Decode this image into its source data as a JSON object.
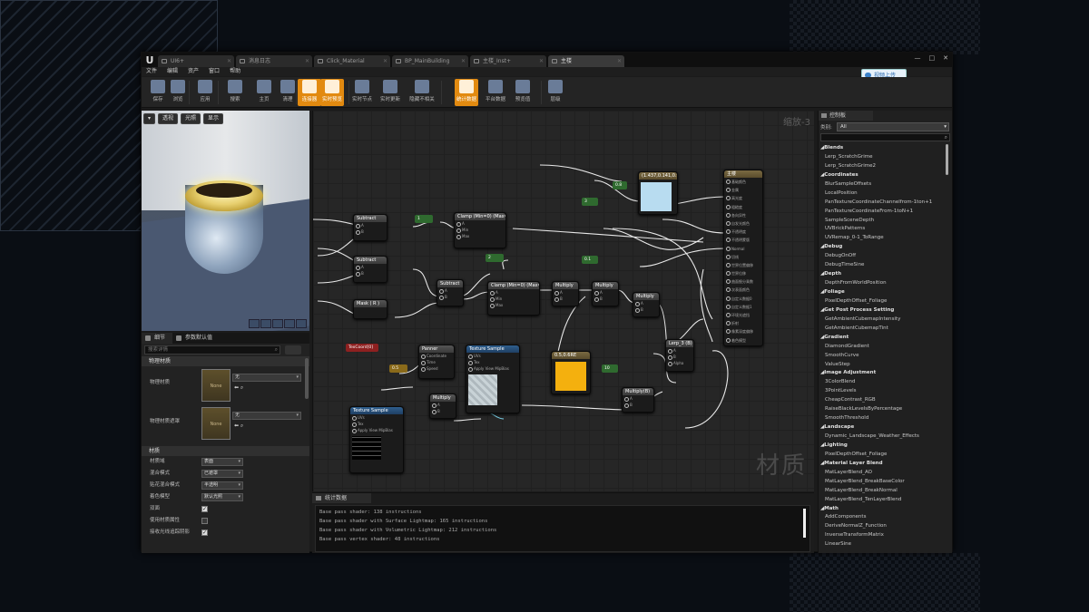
{
  "tabs": [
    {
      "label": "UI6+",
      "active": false
    },
    {
      "label": "消息日志",
      "active": false
    },
    {
      "label": "Click_Material",
      "active": false
    },
    {
      "label": "BP_MainBuilding",
      "active": false
    },
    {
      "label": "主楼_Inst+",
      "active": false
    },
    {
      "label": "主楼",
      "active": true
    }
  ],
  "menu": [
    "文件",
    "编辑",
    "资产",
    "窗口",
    "帮助"
  ],
  "upload_button": "视频上传",
  "toolbar": [
    {
      "label": "保存",
      "icon": "save-icon"
    },
    {
      "label": "浏览",
      "icon": "browse-icon"
    },
    {
      "label": "应用",
      "icon": "apply-icon"
    },
    {
      "label": "搜索",
      "icon": "search-icon"
    },
    {
      "label": "主页",
      "icon": "home-icon"
    },
    {
      "label": "清理",
      "icon": "clean-icon"
    },
    {
      "label": "连接器",
      "icon": "connector-icon",
      "highlighted": true
    },
    {
      "label": "实时预览",
      "icon": "live-preview-icon",
      "highlighted": true
    },
    {
      "label": "实时节点",
      "icon": "live-nodes-icon"
    },
    {
      "label": "实时更新",
      "icon": "live-update-icon"
    },
    {
      "label": "隐藏不相关",
      "icon": "hide-unrelated-icon"
    },
    {
      "label": "统计数据",
      "icon": "stats-icon",
      "highlighted": true
    },
    {
      "label": "平台数据",
      "icon": "platform-stats-icon"
    },
    {
      "label": "预览值",
      "icon": "preview-values-icon"
    },
    {
      "label": "层级",
      "icon": "hierarchy-icon"
    }
  ],
  "viewport": {
    "buttons": [
      "透视",
      "光照",
      "显示"
    ]
  },
  "details": {
    "tabs": [
      "细节",
      "参数默认值"
    ],
    "search_placeholder": "搜索详情",
    "cat_physical": "物理材质",
    "phys_mat_label": "物理材质",
    "phys_mask_label": "物理材质遮罩",
    "none_label": "None",
    "none_value": "无",
    "cat_material": "材质",
    "props": [
      {
        "label": "材质域",
        "value": "表面",
        "type": "select"
      },
      {
        "label": "混合模式",
        "value": "已遮罩",
        "type": "select"
      },
      {
        "label": "贴花混合模式",
        "value": "半透明",
        "type": "select"
      },
      {
        "label": "着色模型",
        "value": "默认光照",
        "type": "select"
      },
      {
        "label": "双面",
        "value": true,
        "type": "check"
      },
      {
        "label": "使用材质属性",
        "value": false,
        "type": "check"
      },
      {
        "label": "接收光线追踪阴影",
        "value": true,
        "type": "check"
      }
    ]
  },
  "graph": {
    "zoom": "缩放-3",
    "watermark": "材质",
    "nodes": {
      "subtract1": "Subtract",
      "subtract2": "Subtract",
      "subtract3": "Subtract",
      "clamp1": "Clamp (Min=0) (Max=1)",
      "clamp2": "Clamp (Min=0) (Max=1)",
      "multiply1": "Multiply",
      "multiply2": "Multiply",
      "multiply3": "Multiply",
      "multiply4": "Multiply",
      "multiply5": "Multiply(B)",
      "lerp": "Lerp_3 (B)",
      "panner": "Panner",
      "texsample1": "Texture Sample",
      "texsample2": "Texture Sample",
      "texcoord": "TexCoord[0]",
      "mask": "Mask ( R )",
      "color_vec": "(1.437,0.141,0.983)",
      "orange": "0.5,0.6RE",
      "output": "主楼",
      "const_1": "1",
      "const_01": "0.1",
      "const_10": "10",
      "const_05": "0.5",
      "const_2": "2",
      "const_08": "0.8",
      "const_3": "3"
    },
    "output_pins": [
      "基础颜色",
      "金属",
      "高光度",
      "粗糙度",
      "各向异性",
      "自发光颜色",
      "不透明度",
      "不透明蒙版",
      "Normal",
      "切线",
      "世界位置偏移",
      "世界位移",
      "曲面细分乘数",
      "次表面颜色",
      "自定义数据0",
      "自定义数据1",
      "环境光遮挡",
      "折射",
      "像素深度偏移",
      "着色模型"
    ],
    "pin_labels": {
      "A": "A",
      "B": "B",
      "Min": "Min",
      "Max": "Max",
      "Alpha": "Alpha",
      "UVs": "UVs",
      "Tex": "Tex",
      "Coordinate": "Coordinate",
      "Time": "Time",
      "Speed": "Speed",
      "ApplyViewMipBias": "Apply View MipBias",
      "RGB": "RGB",
      "R": "R",
      "G": "G",
      "Bc": "B",
      "Ac": "A",
      "RGBA": "RGBA"
    }
  },
  "stats": {
    "tab": "统计数据",
    "lines": [
      "Base pass shader: 138 instructions",
      "Base pass shader with Surface Lightmap: 165 instructions",
      "Base pass shader with Volumetric Lightmap: 212 instructions",
      "Base pass vertex shader: 48 instructions"
    ]
  },
  "palette": {
    "tab": "控制板",
    "category_label": "类别:",
    "category_value": "All",
    "items": [
      {
        "t": "Blends",
        "h": true
      },
      {
        "t": "Lerp_ScratchGrime"
      },
      {
        "t": "Lerp_ScratchGrime2"
      },
      {
        "t": "Coordinates",
        "h": true
      },
      {
        "t": "BlurSampleOffsets"
      },
      {
        "t": "LocalPosition"
      },
      {
        "t": "PanTextureCoordinateChannelfrom-1ton+1"
      },
      {
        "t": "PanTextureCoordinateFrom-1toN+1"
      },
      {
        "t": "SampleSceneDepth"
      },
      {
        "t": "UVBrickPatterns"
      },
      {
        "t": "UVRemap_0-1_ToRange"
      },
      {
        "t": "Debug",
        "h": true
      },
      {
        "t": "DebugOnOff"
      },
      {
        "t": "DebugTimeSine"
      },
      {
        "t": "Depth",
        "h": true
      },
      {
        "t": "DepthFromWorldPosition"
      },
      {
        "t": "Foliage",
        "h": true
      },
      {
        "t": "PixelDepthOffset_Foliage"
      },
      {
        "t": "Get Post Process Setting",
        "h": true
      },
      {
        "t": "GetAmbientCubemapIntensity"
      },
      {
        "t": "GetAmbientCubemapTint"
      },
      {
        "t": "Gradient",
        "h": true
      },
      {
        "t": "DiamondGradient"
      },
      {
        "t": "SmoothCurve"
      },
      {
        "t": "ValueStep"
      },
      {
        "t": "Image Adjustment",
        "h": true
      },
      {
        "t": "3ColorBlend"
      },
      {
        "t": "3PointLevels"
      },
      {
        "t": "CheapContrast_RGB"
      },
      {
        "t": "RaiseBlackLevelsByPercentage"
      },
      {
        "t": "SmoothThreshold"
      },
      {
        "t": "Landscape",
        "h": true
      },
      {
        "t": "Dynamic_Landscape_Weather_Effects"
      },
      {
        "t": "Lighting",
        "h": true
      },
      {
        "t": "PixelDepthOffset_Foliage"
      },
      {
        "t": "Material Layer Blend",
        "h": true
      },
      {
        "t": "MatLayerBlend_AO"
      },
      {
        "t": "MatLayerBlend_BreakBaseColor"
      },
      {
        "t": "MatLayerBlend_BreakNormal"
      },
      {
        "t": "MatLayerBlend_TenLayerBlend"
      },
      {
        "t": "Math",
        "h": true
      },
      {
        "t": "AddComponents"
      },
      {
        "t": "DeriveNormalZ_Function"
      },
      {
        "t": "InverseTransformMatrix"
      },
      {
        "t": "LinearSine"
      }
    ]
  }
}
